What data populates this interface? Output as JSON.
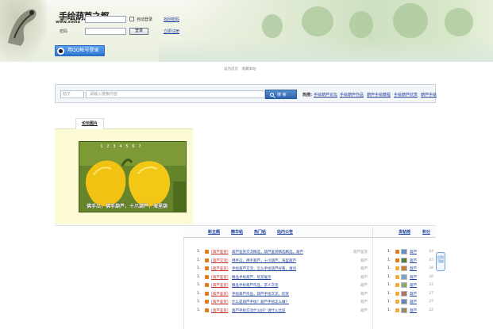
{
  "header": {
    "logo_text": "手绘葫芦之都",
    "logo_sub": "www.xinhu",
    "username_label": "账号",
    "password_label": "密码",
    "remember_label": "自动登录",
    "login_button": "登录",
    "find_password": "找回密码",
    "register": "立即注册",
    "qq_login": "用QQ帐号登录",
    "tagline": "设为首页　收藏本站"
  },
  "search": {
    "select_value": "帖子",
    "placeholder": "请输入搜索内容",
    "button": "搜 索",
    "hot_label": "热搜:",
    "hot_links": [
      "手绘葫芦论坛",
      "手绘葫芦作品",
      "葫芦手绘教程",
      "手绘葫芦欣赏",
      "葫芦手绘"
    ]
  },
  "left_panel": {
    "tab_label": "论坛图片",
    "slide_numbers": [
      "1",
      "2",
      "3",
      "4",
      "5",
      "6",
      "7"
    ],
    "slide_caption": "佛手瓜，佛手葫芦，十爪葫芦，海里葫"
  },
  "thread_tabs": [
    "新主题",
    "精华帖",
    "热门帖",
    "站内公告"
  ],
  "rank_tabs": [
    "发帖榜",
    "积分"
  ],
  "threads": [
    {
      "num": "1.",
      "icon": "#e07b1c",
      "cat": "[葫芦鉴赏]",
      "title": "葫芦鉴赏交流精选，葫芦鉴赏精选精选，葫芦",
      "author": "葫芦鉴赏"
    },
    {
      "num": "1.",
      "icon": "#e07b1c",
      "cat": "[葫芦交流]",
      "title": "佛手瓜，佛手葫芦，十爪葫芦，海里葫芦",
      "author": "葫芦"
    },
    {
      "num": "1.",
      "icon": "#e07b1c",
      "cat": "[葫芦鉴赏]",
      "title": "手绘葫芦交流，怎么手绘葫芦好看，请问",
      "author": "葫芦"
    },
    {
      "num": "1.",
      "icon": "#e07b1c",
      "cat": "[葫芦鉴赏]",
      "title": "精品手绘葫芦，欣赏展示",
      "author": "葫芦"
    },
    {
      "num": "1.",
      "icon": "#e07b1c",
      "cat": "[葫芦鉴赏]",
      "title": "精品手绘葫芦作品，求人交流",
      "author": "葫芦"
    },
    {
      "num": "1.",
      "icon": "#e07b1c",
      "cat": "[葫芦鉴赏]",
      "title": "手绘葫芦作品，葫芦手绘交流，欣赏",
      "author": "葫芦"
    },
    {
      "num": "1.",
      "icon": "#e07b1c",
      "cat": "[葫芦鉴赏]",
      "title": "什么是葫芦手绘？葫芦手绘怎么做？",
      "author": "葫芦"
    },
    {
      "num": "1.",
      "icon": "#e07b1c",
      "cat": "[葫芦鉴赏]",
      "title": "葫芦手绘交流什么好？请什么比较",
      "author": "葫芦"
    }
  ],
  "ranks": [
    {
      "num": "1.",
      "icon": "#e07b1c",
      "avatar": "#6b8fbf",
      "name": "葫芦",
      "score": "64"
    },
    {
      "num": "1.",
      "icon": "#e07b1c",
      "avatar": "#5a7a3a",
      "name": "葫芦",
      "score": "45"
    },
    {
      "num": "1.",
      "icon": "#f3a83a",
      "avatar": "#c08040",
      "name": "葫芦",
      "score": "38"
    },
    {
      "num": "1.",
      "icon": "#f3a83a",
      "avatar": "#7aa0c8",
      "name": "葫芦",
      "score": "36"
    },
    {
      "num": "1.",
      "icon": "#f3a83a",
      "avatar": "#88aa66",
      "name": "葫芦",
      "score": "33"
    },
    {
      "num": "1.",
      "icon": "#f3a83a",
      "avatar": "#aa7766",
      "name": "葫芦",
      "score": "27"
    },
    {
      "num": "1.",
      "icon": "#f3a83a",
      "avatar": "#6688aa",
      "name": "葫芦",
      "score": "25"
    },
    {
      "num": "1.",
      "icon": "#f3a83a",
      "avatar": "#998866",
      "name": "葫芦",
      "score": "22"
    }
  ],
  "back_to_top": "回到顶部"
}
